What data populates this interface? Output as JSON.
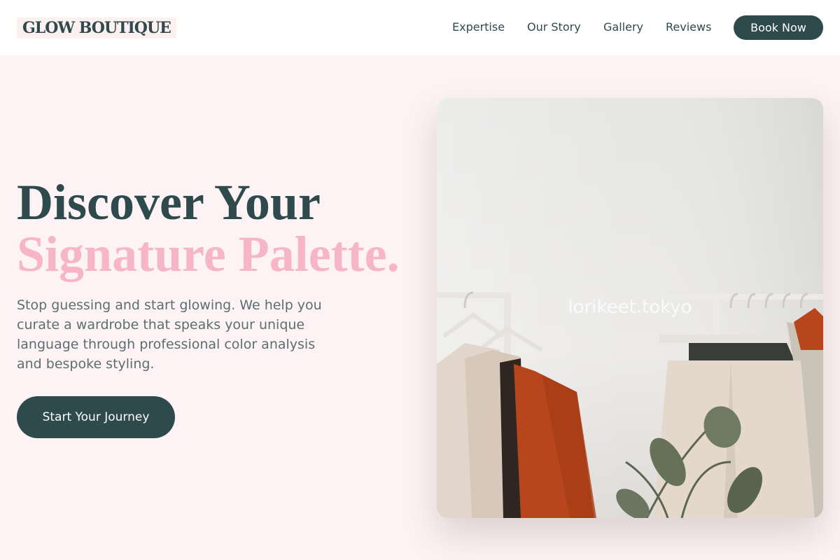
{
  "brand": {
    "name": "GLOW BOUTIQUE"
  },
  "nav": {
    "links": [
      {
        "label": "Expertise"
      },
      {
        "label": "Our Story"
      },
      {
        "label": "Gallery"
      },
      {
        "label": "Reviews"
      }
    ],
    "cta_label": "Book Now"
  },
  "hero": {
    "title_line1": "Discover Your",
    "title_line2": "Signature Palette.",
    "description": "Stop guessing and start glowing. We help you curate a wardrobe that speaks your unique language through professional color analysis and bespoke styling.",
    "cta_label": "Start Your Journey",
    "image_watermark": "lorikeet.tokyo"
  },
  "colors": {
    "primary": "#2f4a4c",
    "accent_pink": "#f6b6c8",
    "background": "#fdf3f4"
  }
}
